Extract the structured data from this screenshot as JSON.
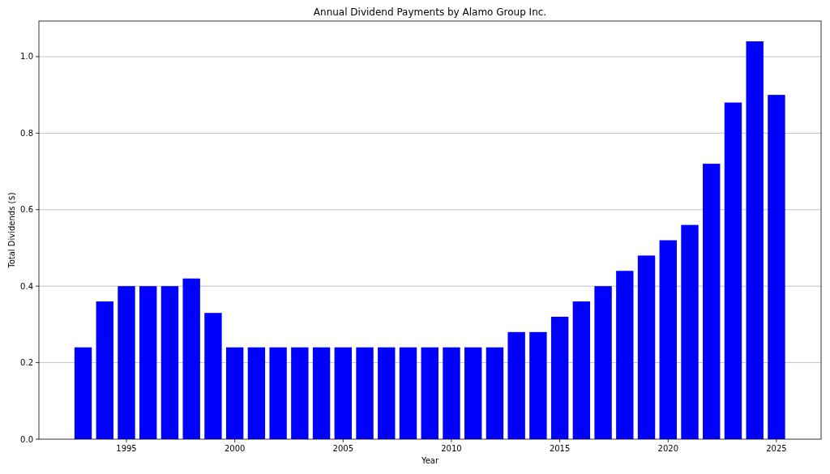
{
  "chart_data": {
    "type": "bar",
    "title": "Annual Dividend Payments by Alamo Group Inc.",
    "xlabel": "Year",
    "ylabel": "Total Dividends ($)",
    "x": [
      1993,
      1994,
      1995,
      1996,
      1997,
      1998,
      1999,
      2000,
      2001,
      2002,
      2003,
      2004,
      2005,
      2006,
      2007,
      2008,
      2009,
      2010,
      2011,
      2012,
      2013,
      2014,
      2015,
      2016,
      2017,
      2018,
      2019,
      2020,
      2021,
      2022,
      2023,
      2024,
      2025
    ],
    "grid": "y",
    "series": [
      {
        "color": "#0000ff",
        "values": [
          0.24,
          0.36,
          0.4,
          0.4,
          0.4,
          0.42,
          0.33,
          0.24,
          0.24,
          0.24,
          0.24,
          0.24,
          0.24,
          0.24,
          0.24,
          0.24,
          0.24,
          0.24,
          0.24,
          0.24,
          0.28,
          0.28,
          0.32,
          0.36,
          0.4,
          0.44,
          0.48,
          0.52,
          0.56,
          0.72,
          0.88,
          1.04,
          0.9
        ]
      }
    ],
    "xlim": [
      1990.96,
      2027.06
    ],
    "ylim": [
      0,
      1.093
    ],
    "xticks": [
      1995,
      2000,
      2005,
      2010,
      2015,
      2020,
      2025
    ],
    "yticks": [
      {
        "value": 0,
        "label": "0.0"
      },
      {
        "value": 0.2,
        "label": "0.2"
      },
      {
        "value": 0.4,
        "label": "0.4"
      },
      {
        "value": 0.6,
        "label": "0.6"
      },
      {
        "value": 0.8,
        "label": "0.8"
      },
      {
        "value": 1.0,
        "label": "1.0"
      }
    ]
  }
}
